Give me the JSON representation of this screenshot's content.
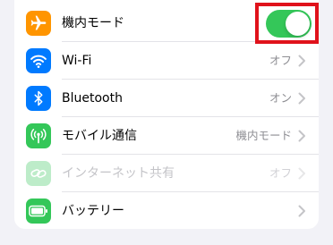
{
  "rows": [
    {
      "label": "機内モード",
      "value": "",
      "icon": "airplane-icon",
      "icon_color": "#ff9500",
      "toggle_on": true,
      "enabled": true
    },
    {
      "label": "Wi-Fi",
      "value": "オフ",
      "icon": "wifi-icon",
      "icon_color": "#007aff",
      "enabled": true
    },
    {
      "label": "Bluetooth",
      "value": "オン",
      "icon": "bluetooth-icon",
      "icon_color": "#007aff",
      "enabled": true
    },
    {
      "label": "モバイル通信",
      "value": "機内モード",
      "icon": "antenna-icon",
      "icon_color": "#34c759",
      "enabled": true
    },
    {
      "label": "インターネット共有",
      "value": "オフ",
      "icon": "link-icon",
      "icon_color": "#34c759",
      "enabled": false
    },
    {
      "label": "バッテリー",
      "value": "",
      "icon": "battery-icon",
      "icon_color": "#34c759",
      "enabled": true
    }
  ],
  "colors": {
    "toggle_on": "#34c759",
    "highlight_border": "#e0121b",
    "secondary_text": "#8e8e93"
  }
}
